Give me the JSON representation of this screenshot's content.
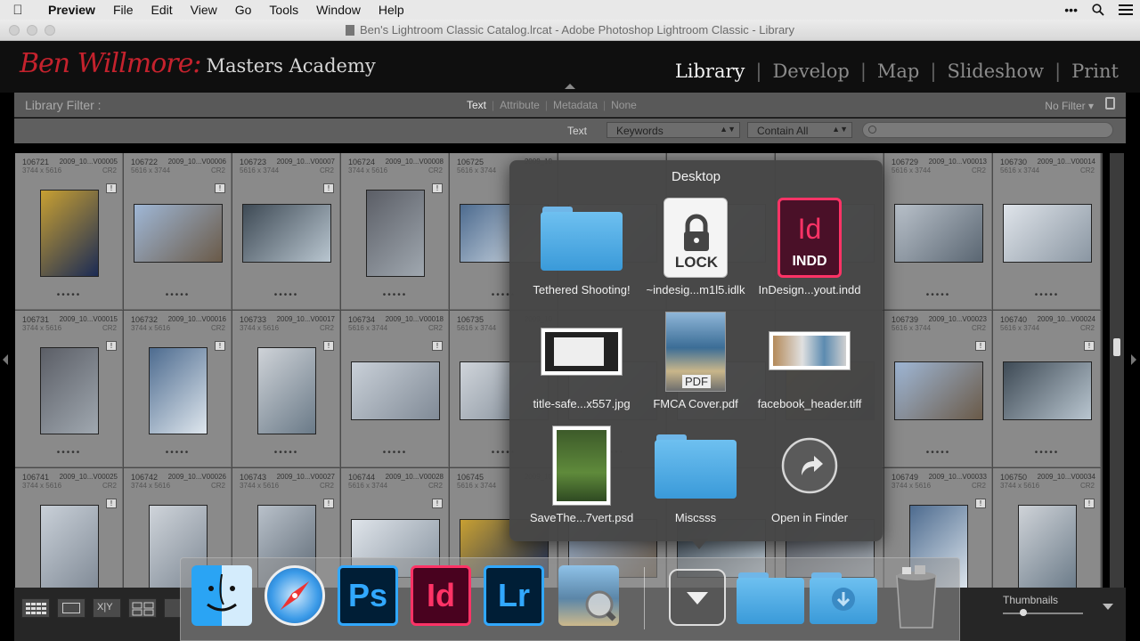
{
  "menubar": {
    "app": "Preview",
    "items": [
      "File",
      "Edit",
      "View",
      "Go",
      "Tools",
      "Window",
      "Help"
    ],
    "right_icons": [
      "more-icon",
      "search-icon",
      "list-icon"
    ]
  },
  "window": {
    "title": "Ben's Lightroom Classic Catalog.lrcat - Adobe Photoshop Lightroom Classic - Library"
  },
  "brand": {
    "script": "Ben Willmore:",
    "rest": "Masters Academy"
  },
  "modules": [
    "Library",
    "Develop",
    "Map",
    "Slideshow",
    "Print"
  ],
  "active_module": "Library",
  "library_filter": {
    "label": "Library Filter :",
    "tabs": [
      "Text",
      "Attribute",
      "Metadata",
      "None"
    ],
    "active_tab": "Text",
    "preset": "No Filter",
    "text_label": "Text",
    "field": "Keywords",
    "rule": "Contain All"
  },
  "grid": {
    "rows": [
      [
        {
          "num": "106721",
          "file": "2009_10...V00005",
          "dims": "3744 x 5616",
          "ext": "CR2",
          "badge": "!"
        },
        {
          "num": "106722",
          "file": "2009_10...V00006",
          "dims": "5616 x 3744",
          "ext": "CR2",
          "badge": "!"
        },
        {
          "num": "106723",
          "file": "2009_10...V00007",
          "dims": "5616 x 3744",
          "ext": "CR2",
          "badge": "!"
        },
        {
          "num": "106724",
          "file": "2009_10...V00008",
          "dims": "3744 x 5616",
          "ext": "CR2",
          "badge": "!"
        },
        {
          "num": "106725",
          "file": "2009_10",
          "dims": "5616 x 3744",
          "ext": "",
          "badge": ""
        },
        {
          "num": "",
          "file": "",
          "dims": "",
          "ext": "",
          "badge": ""
        },
        {
          "num": "",
          "file": "",
          "dims": "",
          "ext": "",
          "badge": ""
        },
        {
          "num": "",
          "file": "",
          "dims": "",
          "ext": "",
          "badge": ""
        },
        {
          "num": "106729",
          "file": "2009_10...V00013",
          "dims": "5616 x 3744",
          "ext": "CR2",
          "badge": ""
        },
        {
          "num": "106730",
          "file": "2009_10...V00014",
          "dims": "5616 x 3744",
          "ext": "CR2",
          "badge": ""
        }
      ],
      [
        {
          "num": "106731",
          "file": "2009_10...V00015",
          "dims": "3744 x 5616",
          "ext": "CR2",
          "badge": "!"
        },
        {
          "num": "106732",
          "file": "2009_10...V00016",
          "dims": "3744 x 5616",
          "ext": "CR2",
          "badge": "!"
        },
        {
          "num": "106733",
          "file": "2009_10...V00017",
          "dims": "3744 x 5616",
          "ext": "CR2",
          "badge": "!"
        },
        {
          "num": "106734",
          "file": "2009_10...V00018",
          "dims": "5616 x 3744",
          "ext": "CR2",
          "badge": "!"
        },
        {
          "num": "106735",
          "file": "2009_10",
          "dims": "5616 x 3744",
          "ext": "",
          "badge": ""
        },
        {
          "num": "",
          "file": "",
          "dims": "",
          "ext": "",
          "badge": ""
        },
        {
          "num": "",
          "file": "",
          "dims": "",
          "ext": "",
          "badge": ""
        },
        {
          "num": "",
          "file": "",
          "dims": "",
          "ext": "",
          "badge": ""
        },
        {
          "num": "106739",
          "file": "2009_10...V00023",
          "dims": "5616 x 3744",
          "ext": "CR2",
          "badge": "!"
        },
        {
          "num": "106740",
          "file": "2009_10...V00024",
          "dims": "5616 x 3744",
          "ext": "CR2",
          "badge": "!"
        }
      ],
      [
        {
          "num": "106741",
          "file": "2009_10...V00025",
          "dims": "3744 x 5616",
          "ext": "CR2",
          "badge": "!"
        },
        {
          "num": "106742",
          "file": "2009_10...V00026",
          "dims": "3744 x 5616",
          "ext": "CR2",
          "badge": ""
        },
        {
          "num": "106743",
          "file": "2009_10...V00027",
          "dims": "3744 x 5616",
          "ext": "CR2",
          "badge": "!"
        },
        {
          "num": "106744",
          "file": "2009_10...V00028",
          "dims": "5616 x 3744",
          "ext": "CR2",
          "badge": "!"
        },
        {
          "num": "106745",
          "file": "2009_10",
          "dims": "5616 x 3744",
          "ext": "",
          "badge": ""
        },
        {
          "num": "",
          "file": "",
          "dims": "",
          "ext": "",
          "badge": ""
        },
        {
          "num": "",
          "file": "",
          "dims": "",
          "ext": "",
          "badge": ""
        },
        {
          "num": "",
          "file": "",
          "dims": "",
          "ext": "",
          "badge": ""
        },
        {
          "num": "106749",
          "file": "2009_10...V00033",
          "dims": "3744 x 5616",
          "ext": "CR2",
          "badge": "!"
        },
        {
          "num": "106750",
          "file": "2009_10...V00034",
          "dims": "3744 x 5616",
          "ext": "CR2",
          "badge": "!"
        }
      ]
    ]
  },
  "stack": {
    "title": "Desktop",
    "items": [
      {
        "label": "Tethered Shooting!",
        "kind": "folder"
      },
      {
        "label": "~indesig...m1l5.idlk",
        "kind": "lock",
        "badge": "LOCK"
      },
      {
        "label": "InDesign...yout.indd",
        "kind": "indd",
        "badge": "Id",
        "sub": "INDD"
      },
      {
        "label": "title-safe...x557.jpg",
        "kind": "image"
      },
      {
        "label": "FMCA Cover.pdf",
        "kind": "pdf",
        "badge": "PDF"
      },
      {
        "label": "facebook_header.tiff",
        "kind": "image-wide"
      },
      {
        "label": "SaveThe...7vert.psd",
        "kind": "photo"
      },
      {
        "label": "Miscsss",
        "kind": "folder"
      },
      {
        "label": "Open in Finder",
        "kind": "finder-arrow"
      }
    ]
  },
  "toolbar": {
    "thumbnails_label": "Thumbnails",
    "thumbnail_size": 0.25
  },
  "dock": {
    "apps": [
      {
        "name": "finder-icon"
      },
      {
        "name": "safari-icon"
      },
      {
        "name": "photoshop-icon",
        "label": "Ps"
      },
      {
        "name": "indesign-icon",
        "label": "Id"
      },
      {
        "name": "lightroom-icon",
        "label": "Lr"
      },
      {
        "name": "preview-icon"
      }
    ],
    "right": [
      "stack-arrow-icon",
      "folder-icon",
      "downloads-folder-icon",
      "trash-icon"
    ]
  },
  "colors": {
    "brand_red": "#c4222d",
    "ps_blue": "#31a8ff",
    "id_pink": "#ff3366",
    "lr_blue": "#31a8ff",
    "folder_blue": "#5ab0e8"
  }
}
